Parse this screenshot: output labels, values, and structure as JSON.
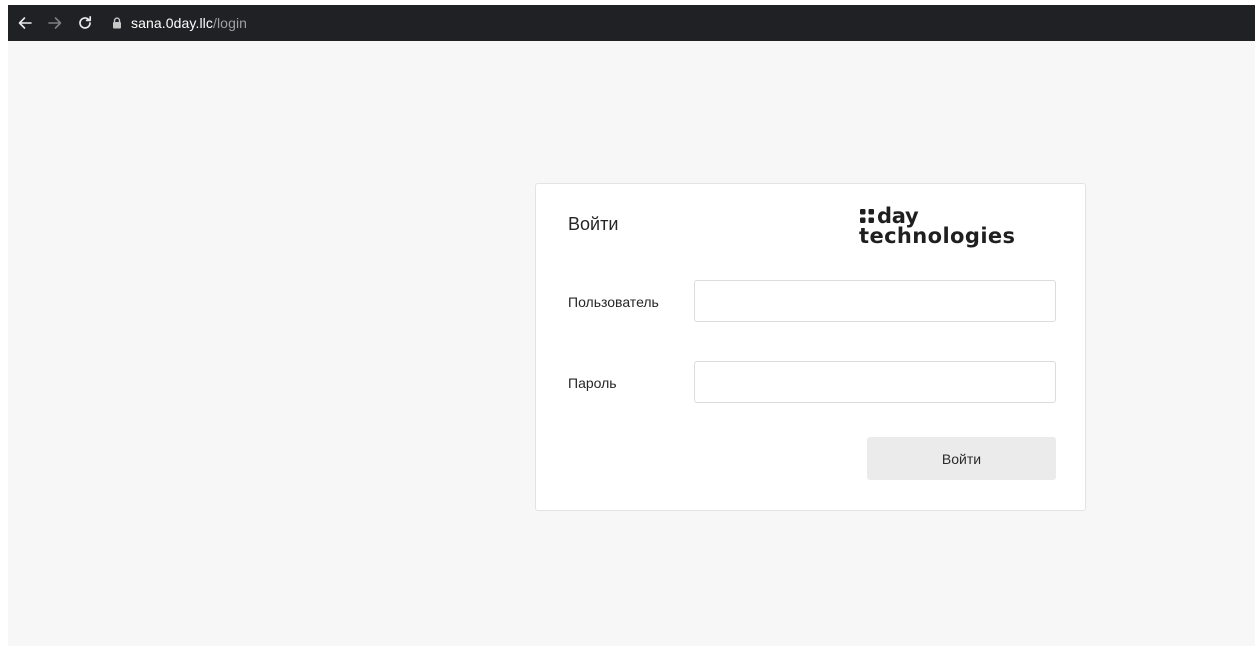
{
  "browser": {
    "back_icon": "arrow-left-icon",
    "forward_icon": "arrow-right-icon",
    "reload_icon": "reload-icon",
    "lock_icon": "lock-icon",
    "url_host": "sana.0day.llc",
    "url_path": "/login"
  },
  "login": {
    "title": "Войти",
    "logo": {
      "word1": "day",
      "word2": "technologies"
    },
    "username_label": "Пользователь",
    "username_value": "",
    "password_label": "Пароль",
    "password_value": "",
    "submit_label": "Войти"
  }
}
